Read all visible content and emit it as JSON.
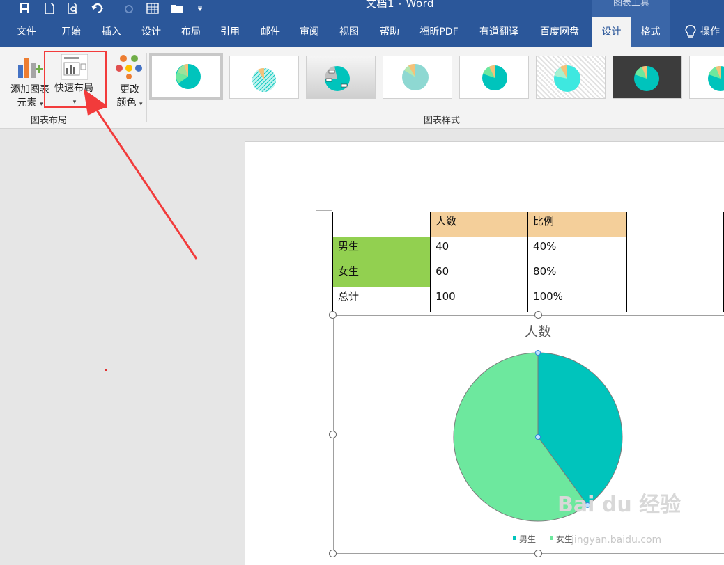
{
  "window": {
    "doc_title": "文档1  -  Word",
    "context_tool": "图表工具"
  },
  "tabs": [
    "文件",
    "开始",
    "插入",
    "设计",
    "布局",
    "引用",
    "邮件",
    "审阅",
    "视图",
    "帮助",
    "福昕PDF",
    "有道翻译",
    "百度网盘",
    "设计",
    "格式"
  ],
  "tell_me": "操作",
  "ribbon": {
    "add_element_line1": "添加图表",
    "add_element_line2": "元素",
    "quick_layout": "快速布局",
    "change_colors_line1": "更改",
    "change_colors_line2": "颜色",
    "group_layout": "图表布局",
    "group_styles": "图表样式"
  },
  "table": {
    "header": [
      "",
      "人数",
      "比例",
      ""
    ],
    "rows": [
      [
        "男生",
        "40",
        "40%"
      ],
      [
        "女生",
        "60",
        "80%"
      ],
      [
        "总计",
        "100",
        "100%"
      ]
    ]
  },
  "chart_data": {
    "type": "pie",
    "title": "人数",
    "categories": [
      "男生",
      "女生"
    ],
    "values": [
      40,
      60
    ],
    "colors": [
      "#00c4bc",
      "#6de89e"
    ],
    "legend": "bottom"
  },
  "colors": {
    "word_blue": "#2b579a",
    "header_orange": "#f4cf9a",
    "row_green": "#92d050",
    "arrow_red": "#f23b3b"
  },
  "watermark": {
    "brand": "Bai du 经验",
    "url": "jingyan.baidu.com"
  }
}
